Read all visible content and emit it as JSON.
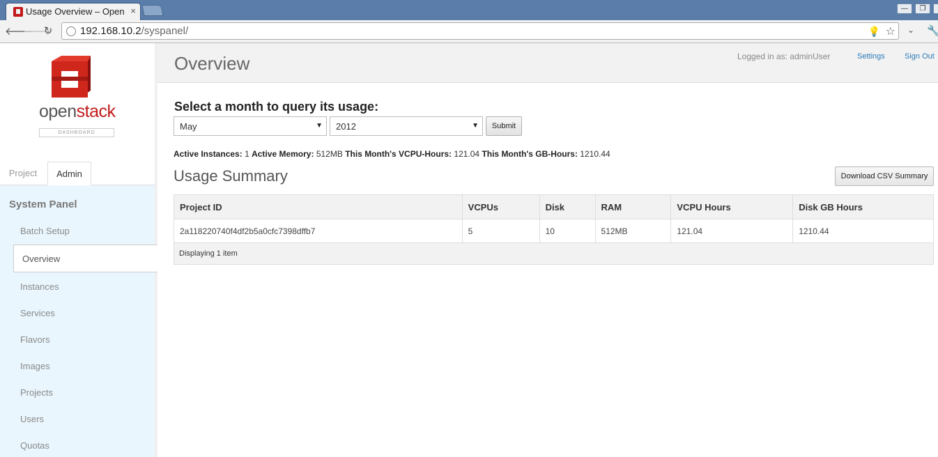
{
  "browser": {
    "tab_title": "Usage Overview – OpenStack",
    "tab_close": "×",
    "url_host": "192.168.10.2",
    "url_path": "/syspanel/"
  },
  "sidebar": {
    "logo_open": "open",
    "logo_stack": "stack",
    "logo_subtitle": "DASHBOARD",
    "tabs": [
      "Project",
      "Admin"
    ],
    "panel_title": "System Panel",
    "items": [
      "Batch Setup",
      "Overview",
      "Instances",
      "Services",
      "Flavors",
      "Images",
      "Projects",
      "Users",
      "Quotas"
    ],
    "active_item": "Overview"
  },
  "header": {
    "title": "Overview",
    "logged_in": "Logged in as: adminUser",
    "settings": "Settings",
    "sign_out": "Sign Out"
  },
  "query": {
    "heading": "Select a month to query its usage:",
    "month": "May",
    "year": "2012",
    "submit": "Submit"
  },
  "stats": {
    "active_instances_label": "Active Instances:",
    "active_instances": "1",
    "active_memory_label": "Active Memory:",
    "active_memory": "512MB",
    "vcpu_hours_label": "This Month's VCPU-Hours:",
    "vcpu_hours": "121.04",
    "gb_hours_label": "This Month's GB-Hours:",
    "gb_hours": "1210.44"
  },
  "usage": {
    "title": "Usage Summary",
    "download_csv": "Download CSV Summary",
    "columns": [
      "Project ID",
      "VCPUs",
      "Disk",
      "RAM",
      "VCPU Hours",
      "Disk GB Hours"
    ],
    "rows": [
      [
        "2a118220740f4df2b5a0cfc7398dffb7",
        "5",
        "10",
        "512MB",
        "121.04",
        "1210.44"
      ]
    ],
    "footer": "Displaying 1 item"
  },
  "colors": {
    "accent_red": "#c21a1a",
    "link_blue": "#2a7ab8",
    "sidebar_panel": "#e9f6fd"
  }
}
